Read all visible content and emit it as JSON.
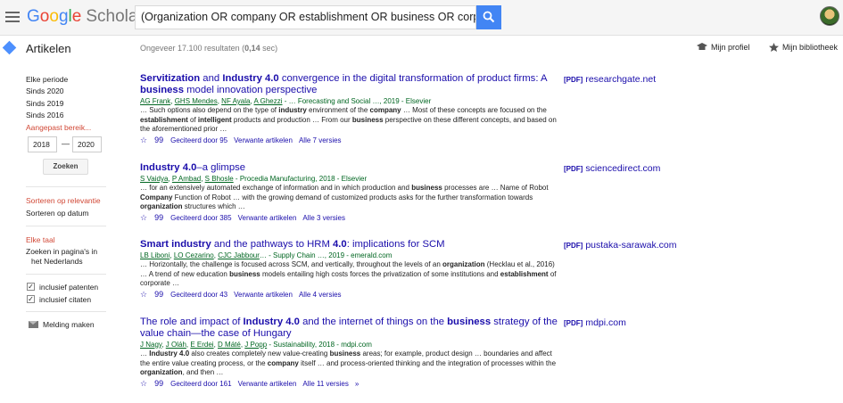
{
  "header": {
    "logo_google": [
      "G",
      "o",
      "o",
      "g",
      "l",
      "e"
    ],
    "logo_scholar": "Scholar",
    "search_value": "(Organization OR company OR establishment OR business OR corporation) ..."
  },
  "subheader": {
    "section_label": "Artikelen",
    "results_prefix": "Ongeveer 17.100 resultaten (",
    "results_time": "0,14",
    "results_suffix": " sec)",
    "profile_label": "Mijn profiel",
    "library_label": "Mijn bibliotheek"
  },
  "sidebar": {
    "periods": [
      "Elke periode",
      "Sinds 2020",
      "Sinds 2019",
      "Sinds 2016",
      "Aangepast bereik..."
    ],
    "year_from": "2018",
    "year_to": "2020",
    "search_button": "Zoeken",
    "sort": [
      "Sorteren op relevantie",
      "Sorteren op datum"
    ],
    "languages": [
      "Elke taal",
      "Zoeken in pagina's in",
      "het Nederlands"
    ],
    "checkboxes": [
      "inclusief patenten",
      "inclusief citaten"
    ],
    "checkbox_mark": "✓",
    "alert_label": "Melding maken"
  },
  "results": [
    {
      "title_parts": [
        {
          "t": "Servitization",
          "b": true
        },
        {
          "t": " and ",
          "b": false
        },
        {
          "t": "Industry 4.0",
          "b": true
        },
        {
          "t": " convergence in the digital transformation of product firms: A ",
          "b": false
        },
        {
          "t": "business",
          "b": true
        },
        {
          "t": " model innovation perspective",
          "b": false
        }
      ],
      "authors": [
        "AG Frank",
        "GHS Mendes",
        "NF Ayala",
        "A Ghezzi"
      ],
      "source": " - … Forecasting and Social …, 2019 - Elsevier",
      "snippet_parts": [
        {
          "t": "… Such options also depend on the type of ",
          "b": false
        },
        {
          "t": "industry",
          "b": true
        },
        {
          "t": " environment of the ",
          "b": false
        },
        {
          "t": "company",
          "b": true
        },
        {
          "t": " … Most of these concepts are focused on the ",
          "b": false
        },
        {
          "t": "establishment",
          "b": true
        },
        {
          "t": " of ",
          "b": false
        },
        {
          "t": "intelligent",
          "b": true
        },
        {
          "t": " products and production … From our ",
          "b": false
        },
        {
          "t": "business",
          "b": true
        },
        {
          "t": " perspective on these different concepts, and based on the aforementioned prior …",
          "b": false
        }
      ],
      "cited": "Geciteerd door 95",
      "related": "Verwante artikelen",
      "versions": "Alle 7 versies",
      "pdf_tag": "[PDF]",
      "pdf_domain": "researchgate.net"
    },
    {
      "title_parts": [
        {
          "t": "Industry 4.0",
          "b": true
        },
        {
          "t": "–a glimpse",
          "b": false
        }
      ],
      "authors": [
        "S Vaidya",
        "P Ambad",
        "S Bhosle"
      ],
      "source": " - Procedia Manufacturing, 2018 - Elsevier",
      "snippet_parts": [
        {
          "t": "… for an extensively automated exchange of information and in which production and ",
          "b": false
        },
        {
          "t": "business",
          "b": true
        },
        {
          "t": " processes are … Name of Robot ",
          "b": false
        },
        {
          "t": "Company",
          "b": true
        },
        {
          "t": " Function of Robot … with the growing demand of customized products asks for the further transformation towards ",
          "b": false
        },
        {
          "t": "organization",
          "b": true
        },
        {
          "t": " structures which …",
          "b": false
        }
      ],
      "cited": "Geciteerd door 385",
      "related": "Verwante artikelen",
      "versions": "Alle 3 versies",
      "pdf_tag": "[PDF]",
      "pdf_domain": "sciencedirect.com"
    },
    {
      "title_parts": [
        {
          "t": "Smart industry",
          "b": true
        },
        {
          "t": " and the pathways to HRM ",
          "b": false
        },
        {
          "t": "4.0",
          "b": true
        },
        {
          "t": ": implications for SCM",
          "b": false
        }
      ],
      "authors": [
        "LB Liboni",
        "LO Cezarino",
        "CJC Jabbour"
      ],
      "source": "… - Supply Chain …, 2019 - emerald.com",
      "snippet_parts": [
        {
          "t": "… Horizontally, the challenge is focused across SCM, and vertically, throughout the levels of an ",
          "b": false
        },
        {
          "t": "organization",
          "b": true
        },
        {
          "t": " (Hecklau et al., 2016) … A trend of new education ",
          "b": false
        },
        {
          "t": "business",
          "b": true
        },
        {
          "t": " models entailing high costs forces the privatization of some institutions and ",
          "b": false
        },
        {
          "t": "establishment",
          "b": true
        },
        {
          "t": " of corporate …",
          "b": false
        }
      ],
      "cited": "Geciteerd door 43",
      "related": "Verwante artikelen",
      "versions": "Alle 4 versies",
      "pdf_tag": "[PDF]",
      "pdf_domain": "pustaka-sarawak.com"
    },
    {
      "title_parts": [
        {
          "t": "The role and impact of ",
          "b": false
        },
        {
          "t": "Industry 4.0",
          "b": true
        },
        {
          "t": " and the internet of things on the ",
          "b": false
        },
        {
          "t": "business",
          "b": true
        },
        {
          "t": " strategy of the value chain—the case of Hungary",
          "b": false
        }
      ],
      "authors": [
        "J Nagy",
        "J Oláh",
        "E Erdei",
        "D Máté",
        "J Popp"
      ],
      "source": " - Sustainability, 2018 - mdpi.com",
      "snippet_parts": [
        {
          "t": "… ",
          "b": false
        },
        {
          "t": "Industry 4.0",
          "b": true
        },
        {
          "t": " also creates completely new value-creating ",
          "b": false
        },
        {
          "t": "business",
          "b": true
        },
        {
          "t": " areas; for example, product design … boundaries and affect the entire value creating process, or the ",
          "b": false
        },
        {
          "t": "company",
          "b": true
        },
        {
          "t": " itself … and process-oriented thinking and the integration of processes within the ",
          "b": false
        },
        {
          "t": "organization",
          "b": true
        },
        {
          "t": ", and then …",
          "b": false
        }
      ],
      "cited": "Geciteerd door 161",
      "related": "Verwante artikelen",
      "versions": "Alle 11 versies",
      "pdf_tag": "[PDF]",
      "pdf_domain": "mdpi.com"
    }
  ],
  "icons": {
    "star": "☆",
    "cite": "99",
    "more": "»"
  },
  "colors": {
    "link": "#1a0dab",
    "author_green": "#006621",
    "active_red": "#d14836",
    "search_blue": "#4285f4"
  }
}
